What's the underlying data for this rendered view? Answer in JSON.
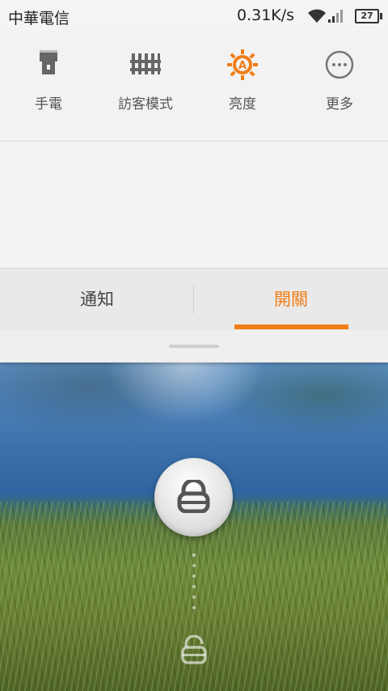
{
  "status_bar": {
    "carrier": "中華電信",
    "net_speed": "0.31K/s",
    "battery_level": "27",
    "icons": [
      "wifi-icon",
      "signal-icon",
      "battery-icon"
    ]
  },
  "quick_toggles": [
    {
      "label": "手電",
      "icon": "flashlight-icon"
    },
    {
      "label": "訪客模式",
      "icon": "guest-mode-icon"
    },
    {
      "label": "亮度",
      "icon": "brightness-auto-icon",
      "active": true
    },
    {
      "label": "更多",
      "icon": "more-icon"
    }
  ],
  "tabs": {
    "notify_label": "通知",
    "switch_label": "開關",
    "selected": "switch"
  },
  "colors": {
    "accent": "#f07d16",
    "shade_bg": "#f2f2f2",
    "status_bar_bg": "#f4f4f4"
  },
  "lock_screen": {
    "center_icon": "lock-icon",
    "target_icon": "unlock-icon"
  }
}
